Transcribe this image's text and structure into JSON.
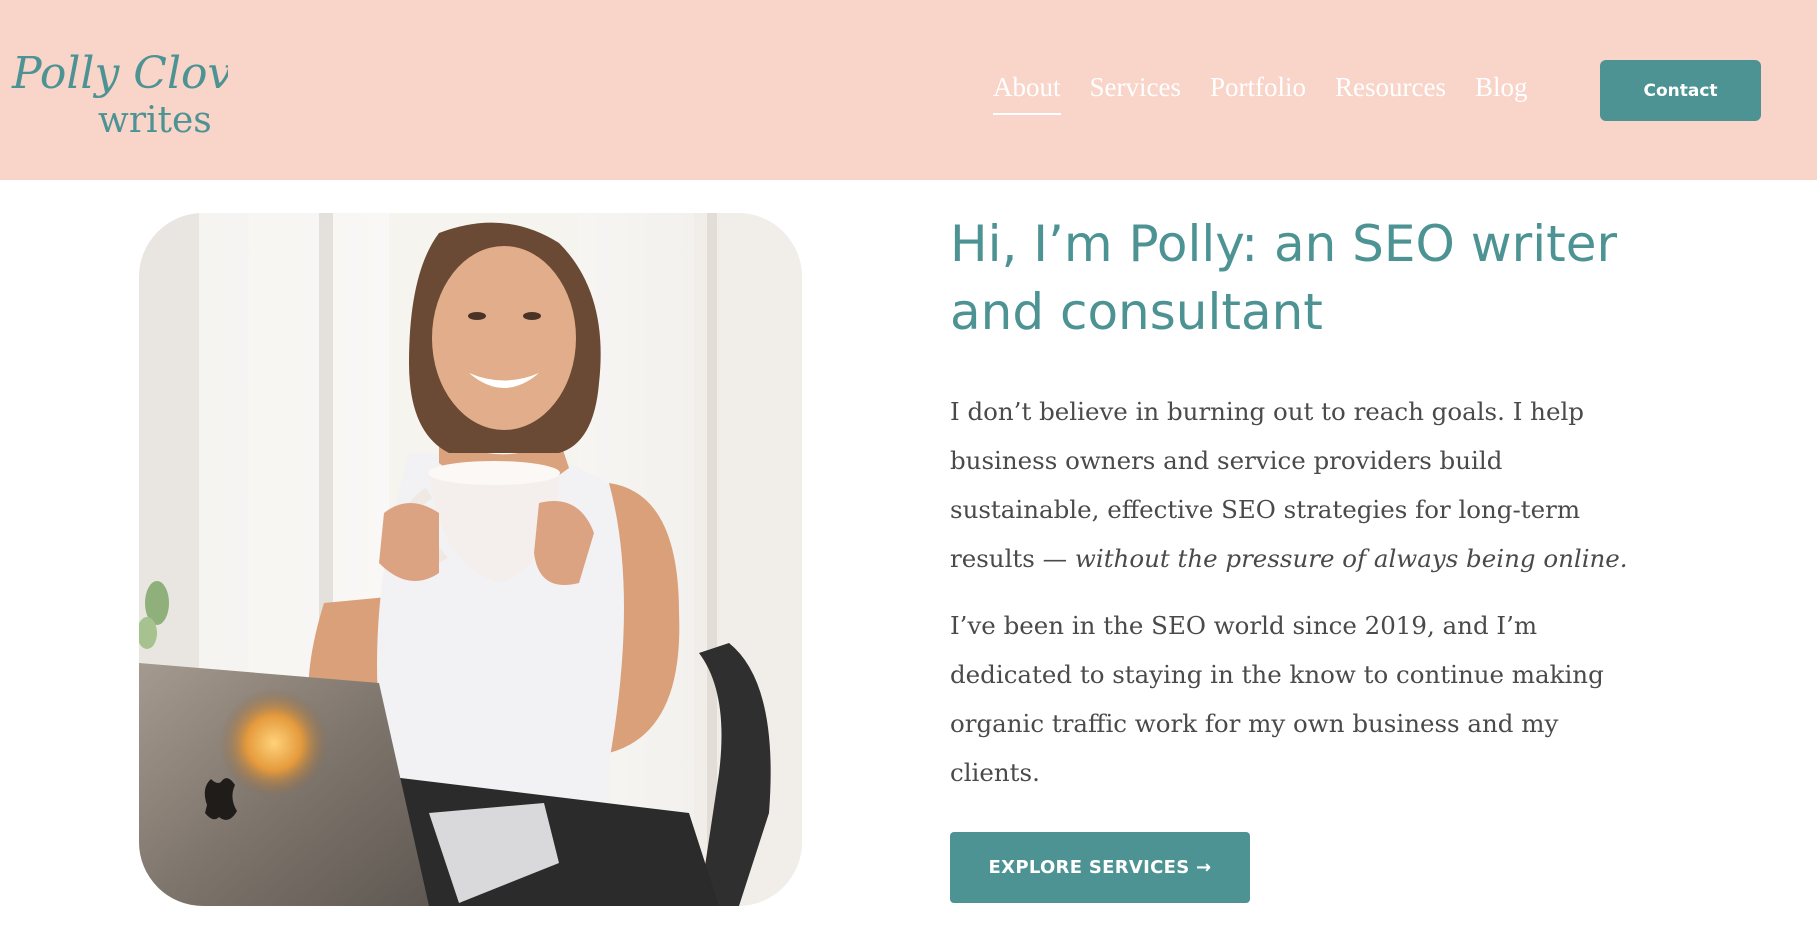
{
  "header": {
    "logo": {
      "line1": "Polly Clover",
      "line2": "writes"
    },
    "nav": [
      {
        "label": "About",
        "active": true
      },
      {
        "label": "Services",
        "active": false
      },
      {
        "label": "Portfolio",
        "active": false
      },
      {
        "label": "Resources",
        "active": false
      },
      {
        "label": "Blog",
        "active": false
      }
    ],
    "contact_label": "Contact"
  },
  "hero": {
    "headline": "Hi, I’m Polly: an SEO writer and consultant",
    "para1_text": "I don’t believe in burning out to reach goals. I help business owners and service providers build sustainable, effective SEO strategies for long-term results — ",
    "para1_emphasis": "without the pressure of always being online.",
    "para2_text": "I’ve been in the SEO world since 2019, and I’m dedicated to staying in the know to continue making organic traffic work for my own business and my clients.",
    "cta_label": "EXPLORE SERVICES →"
  },
  "colors": {
    "header_bg": "#f9d4c9",
    "accent": "#4d9393",
    "body_text": "#4a4a4a"
  }
}
